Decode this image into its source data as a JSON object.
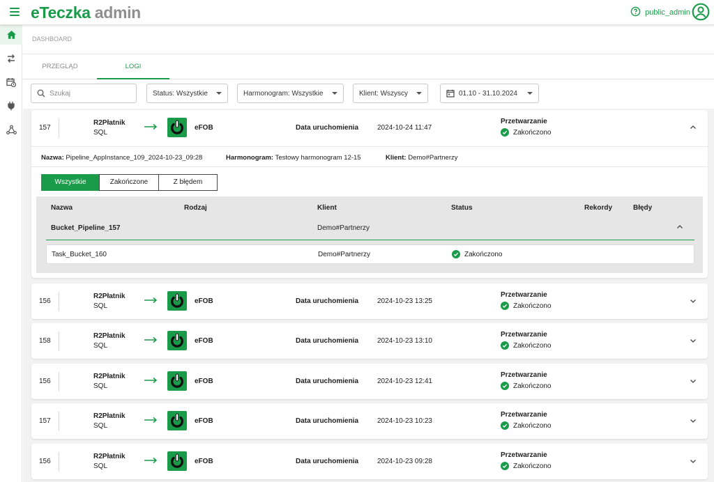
{
  "header": {
    "logo_main": "eTeczka",
    "logo_sub": "admin",
    "username": "public_admin"
  },
  "breadcrumb": "DASHBOARD",
  "tabs": [
    {
      "label": "PRZEGLĄD",
      "active": false
    },
    {
      "label": "LOGI",
      "active": true
    }
  ],
  "filters": {
    "search_placeholder": "Szukaj",
    "status": "Status: Wszystkie",
    "schedule": "Harmonogram: Wszystkie",
    "client": "Klient: Wszyscy",
    "date_range": "01.10 - 31.10.2024"
  },
  "expanded": {
    "id": "157",
    "source_name": "R2Płatnik",
    "source_type": "SQL",
    "target": "eFOB",
    "date_label": "Data uruchomienia",
    "date": "2024-10-24 11:47",
    "status_title": "Przetwarzanie",
    "status": "Zakończono",
    "meta": {
      "name_label": "Nazwa:",
      "name": "Pipeline_AppInstance_109_2024-10-23_09:28",
      "schedule_label": "Harmonogram:",
      "schedule": "Testowy harmonogram 12-15",
      "client_label": "Klient:",
      "client": "Demo#Partnerzy"
    },
    "segments": [
      "Wszystkie",
      "Zakończone",
      "Z błędem"
    ],
    "columns": [
      "Nazwa",
      "Rodzaj",
      "Klient",
      "Status",
      "Rekordy",
      "Błędy"
    ],
    "group": {
      "name": "Bucket_Pipeline_157",
      "client": "Demo#Partnerzy"
    },
    "task": {
      "name": "Task_Bucket_160",
      "client": "Demo#Partnerzy",
      "status": "Zakończono"
    }
  },
  "rows": [
    {
      "id": "156",
      "source_name": "R2Płatnik",
      "source_type": "SQL",
      "target": "eFOB",
      "date_label": "Data uruchomienia",
      "date": "2024-10-23 13:25",
      "status_title": "Przetwarzanie",
      "status": "Zakończono"
    },
    {
      "id": "158",
      "source_name": "R2Płatnik",
      "source_type": "SQL",
      "target": "eFOB",
      "date_label": "Data uruchomienia",
      "date": "2024-10-23 13:10",
      "status_title": "Przetwarzanie",
      "status": "Zakończono"
    },
    {
      "id": "156",
      "source_name": "R2Płatnik",
      "source_type": "SQL",
      "target": "eFOB",
      "date_label": "Data uruchomienia",
      "date": "2024-10-23 12:41",
      "status_title": "Przetwarzanie",
      "status": "Zakończono"
    },
    {
      "id": "157",
      "source_name": "R2Płatnik",
      "source_type": "SQL",
      "target": "eFOB",
      "date_label": "Data uruchomienia",
      "date": "2024-10-23 10:23",
      "status_title": "Przetwarzanie",
      "status": "Zakończono"
    },
    {
      "id": "156",
      "source_name": "R2Płatnik",
      "source_type": "SQL",
      "target": "eFOB",
      "date_label": "Data uruchomienia",
      "date": "2024-10-23 09:28",
      "status_title": "Przetwarzanie",
      "status": "Zakończono"
    }
  ],
  "colors": {
    "accent": "#1a9b4a"
  }
}
